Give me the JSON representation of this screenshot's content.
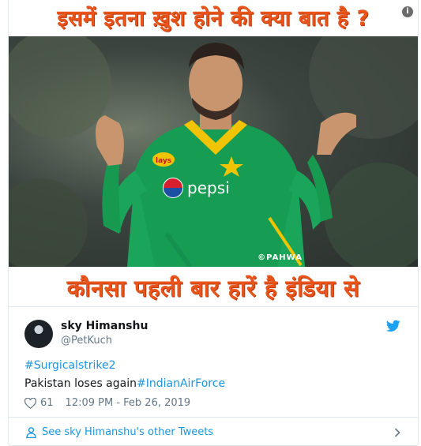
{
  "media": {
    "caption_top": "इसमें इतना ख़ुश होने की क्या बात है ?",
    "caption_bottom": "कौनसा पहली बार हारें है इंडिया से",
    "info_badge": "i",
    "watermark": "©PAHWA",
    "jersey_brand": "pepsi",
    "jersey_sponsor": "lays",
    "colors": {
      "caption": "#e8541a",
      "jersey": "#1aa55a",
      "jersey_trim": "#f2c400"
    }
  },
  "tweet": {
    "display_name": "sky Himanshu",
    "handle": "@PetKuch",
    "hashtag_line": "#Surgicalstrike2",
    "text_plain": "Pakistan loses again",
    "text_tag": "#IndianAirForce",
    "like_count": "61",
    "timestamp": "12:09 PM - Feb 26, 2019",
    "colors": {
      "link": "#1b95e0",
      "meta": "#657786"
    }
  },
  "footer": {
    "label": "See sky Himanshu's other Tweets"
  }
}
